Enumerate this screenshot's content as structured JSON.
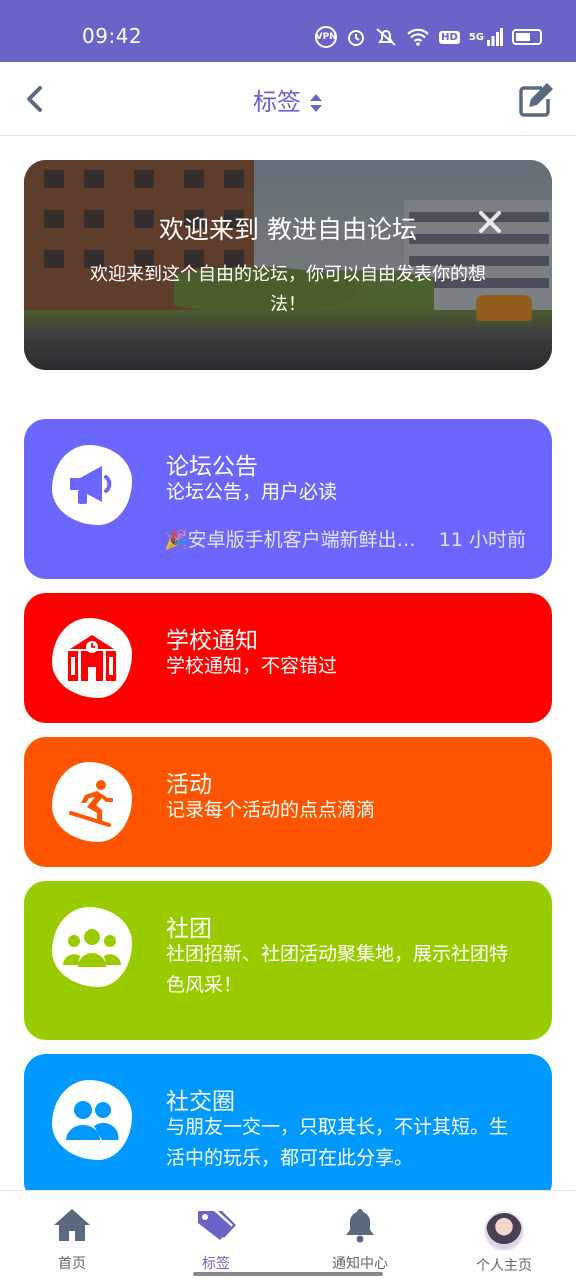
{
  "status_bar": {
    "time": "09:42",
    "vpn_label": "VPN",
    "hd_label": "HD",
    "network_label": "5G"
  },
  "header": {
    "title": "标签"
  },
  "banner": {
    "title": "欢迎来到 教进自由论坛",
    "text": "欢迎来到这个自由的论坛，你可以自由发表你的想法！"
  },
  "categories": [
    {
      "title": "论坛公告",
      "description": "论坛公告，用户必读",
      "latest_post": "🎉安卓版手机客户端新鲜出…",
      "latest_time": "11 小时前",
      "color": "#6b67fe",
      "icon": "megaphone-icon"
    },
    {
      "title": "学校通知",
      "description": "学校通知，不容错过",
      "color": "#ff0000",
      "icon": "school-icon"
    },
    {
      "title": "活动",
      "description": "记录每个活动的点点滴滴",
      "color": "#ff5500",
      "icon": "snowboarding-icon"
    },
    {
      "title": "社团",
      "description": "社团招新、社团活动聚集地，展示社团特色风采！",
      "color": "#99cc00",
      "icon": "group-icon"
    },
    {
      "title": "社交圈",
      "description": "与朋友一交一，只取其长，不计其短。生活中的玩乐，都可在此分享。",
      "color": "#0099ff",
      "icon": "users-icon"
    }
  ],
  "tabbar": {
    "items": [
      {
        "label": "首页",
        "icon": "home-icon"
      },
      {
        "label": "标签",
        "icon": "tag-icon",
        "active": true
      },
      {
        "label": "通知中心",
        "icon": "bell-icon"
      },
      {
        "label": "个人主页",
        "icon": "avatar"
      }
    ]
  },
  "colors": {
    "accent": "#6a64c8",
    "status_bar": "#6a64c8"
  }
}
